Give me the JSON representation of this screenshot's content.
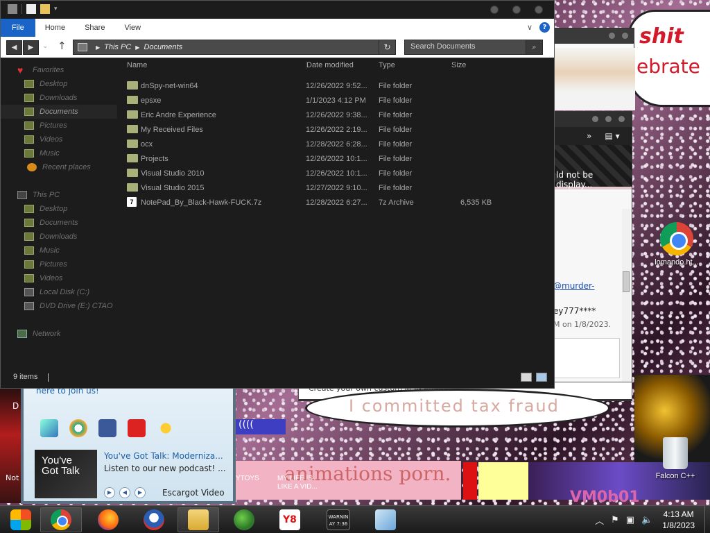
{
  "desktop": {
    "speech_top_1": "shit",
    "speech_top_2": "ebrate",
    "bubble_text": "I committed tax fraud",
    "strip_text": "animations porn.",
    "strip_label_1": "YTOYS",
    "strip_label_2": "MY LIFE IS LIKE A VID...",
    "lakers_text": "VM0b01",
    "left_d": "D",
    "left_n": "Not",
    "icons": [
      {
        "label": "lomando.ht...",
        "icon": "chrome-icon"
      },
      {
        "label": "Falcon C++",
        "icon": "recycle-bin-icon"
      }
    ]
  },
  "ie_window": {
    "ie_error": "ld not be display...",
    "link": "@murder-",
    "line2": "ey777****",
    "line3": "M on 1/8/2023.",
    "bottom_bar": "Create your own custom MSN emoticons"
  },
  "aol_window": {
    "join": "here to join us!",
    "title": "You've Got Talk: Moderniza...",
    "subtitle": "Listen to our new podcast! ...",
    "thumb": "You've Got Talk",
    "player_label": "Escargot Video"
  },
  "explorer": {
    "ribbon": {
      "file": "File",
      "home": "Home",
      "share": "Share",
      "view": "View"
    },
    "address": {
      "this_pc": "This PC",
      "documents": "Documents"
    },
    "search_placeholder": "Search Documents",
    "nav": [
      {
        "label": "Favorites",
        "icon": "star-icon",
        "top": true
      },
      {
        "label": "Desktop",
        "icon": "desktop-folder-icon"
      },
      {
        "label": "Downloads",
        "icon": "downloads-folder-icon"
      },
      {
        "label": "Documents",
        "icon": "documents-folder-icon",
        "selected": true
      },
      {
        "label": "Pictures",
        "icon": "pictures-folder-icon"
      },
      {
        "label": "Videos",
        "icon": "videos-folder-icon"
      },
      {
        "label": "Music",
        "icon": "music-folder-icon"
      },
      {
        "label": "Recent places",
        "icon": "recent-places-icon"
      },
      {
        "label": "This PC",
        "icon": "computer-icon",
        "top": true
      },
      {
        "label": "Desktop",
        "icon": "desktop-folder-icon"
      },
      {
        "label": "Documents",
        "icon": "documents-folder-icon"
      },
      {
        "label": "Downloads",
        "icon": "downloads-folder-icon"
      },
      {
        "label": "Music",
        "icon": "music-folder-icon"
      },
      {
        "label": "Pictures",
        "icon": "pictures-folder-icon"
      },
      {
        "label": "Videos",
        "icon": "videos-folder-icon"
      },
      {
        "label": "Local Disk (C:)",
        "icon": "drive-icon"
      },
      {
        "label": "DVD Drive (E:) CTAO",
        "icon": "dvd-drive-icon"
      },
      {
        "label": "Network",
        "icon": "network-icon",
        "top": true
      }
    ],
    "columns": {
      "name": "Name",
      "date": "Date modified",
      "type": "Type",
      "size": "Size"
    },
    "files": [
      {
        "name": "dnSpy-net-win64",
        "date": "12/26/2022 9:52...",
        "type": "File folder",
        "size": ""
      },
      {
        "name": "epsxe",
        "date": "1/1/2023 4:12 PM",
        "type": "File folder",
        "size": ""
      },
      {
        "name": "Eric Andre Experience",
        "date": "12/26/2022 9:38...",
        "type": "File folder",
        "size": ""
      },
      {
        "name": "My Received Files",
        "date": "12/26/2022 2:19...",
        "type": "File folder",
        "size": ""
      },
      {
        "name": "ocx",
        "date": "12/28/2022 6:28...",
        "type": "File folder",
        "size": ""
      },
      {
        "name": "Projects",
        "date": "12/26/2022 10:1...",
        "type": "File folder",
        "size": ""
      },
      {
        "name": "Visual Studio 2010",
        "date": "12/26/2022 10:1...",
        "type": "File folder",
        "size": ""
      },
      {
        "name": "Visual Studio 2015",
        "date": "12/27/2022 9:10...",
        "type": "File folder",
        "size": ""
      },
      {
        "name": "NotePad_By_Black-Hawk-FUCK.7z",
        "date": "12/28/2022 6:27...",
        "type": "7z Archive",
        "size": "6,535 KB"
      }
    ],
    "status": {
      "items": "9 items"
    }
  },
  "taskbar": {
    "apps": [
      {
        "name": "start-button",
        "icon": "start-icon"
      },
      {
        "name": "chrome-taskbar",
        "icon": "chrome-icon",
        "active": true
      },
      {
        "name": "firefox-taskbar",
        "icon": "firefox-icon"
      },
      {
        "name": "obama-taskbar",
        "icon": "obama-icon"
      },
      {
        "name": "explorer-taskbar",
        "icon": "folder-icon",
        "active": true
      },
      {
        "name": "msn-taskbar",
        "icon": "msn-icon"
      },
      {
        "name": "y8-taskbar",
        "icon": "y8-icon",
        "text": "Y8"
      },
      {
        "name": "warning-taskbar",
        "icon": "warning-icon",
        "text": "WARNIN AY 7:36"
      },
      {
        "name": "installer-taskbar",
        "icon": "installer-icon"
      }
    ],
    "time": "4:13 AM",
    "date": "1/8/2023"
  }
}
